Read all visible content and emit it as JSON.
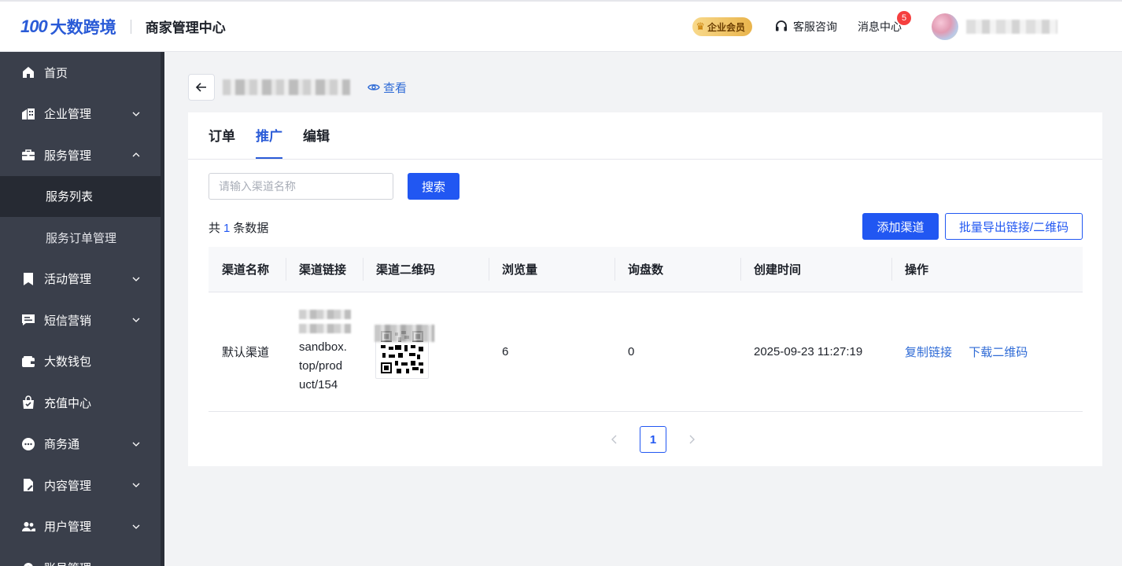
{
  "header": {
    "logo_mark": "100",
    "logo_text": "大数跨境",
    "center_title": "商家管理中心",
    "vip_label": "企业会员",
    "support_label": "客服咨询",
    "message_label": "消息中心",
    "message_count": "5"
  },
  "sidebar": {
    "items": [
      {
        "label": "首页",
        "icon": "home-icon",
        "chevron": "none"
      },
      {
        "label": "企业管理",
        "icon": "building-icon",
        "chevron": "down"
      },
      {
        "label": "服务管理",
        "icon": "briefcase-icon",
        "chevron": "up"
      },
      {
        "label": "活动管理",
        "icon": "bookmark-icon",
        "chevron": "down"
      },
      {
        "label": "短信营销",
        "icon": "message-icon",
        "chevron": "down"
      },
      {
        "label": "大数钱包",
        "icon": "wallet-icon",
        "chevron": "none"
      },
      {
        "label": "充值中心",
        "icon": "bag-icon",
        "chevron": "none"
      },
      {
        "label": "商务通",
        "icon": "chat-icon",
        "chevron": "down"
      },
      {
        "label": "内容管理",
        "icon": "document-icon",
        "chevron": "down"
      },
      {
        "label": "用户管理",
        "icon": "users-icon",
        "chevron": "down"
      },
      {
        "label": "账号管理",
        "icon": "gear-icon",
        "chevron": "none"
      }
    ],
    "sub_items": [
      {
        "label": "服务列表",
        "active": true
      },
      {
        "label": "服务订单管理",
        "active": false
      }
    ]
  },
  "page": {
    "view_label": "查看",
    "tabs": [
      {
        "label": "订单",
        "active": false
      },
      {
        "label": "推广",
        "active": true
      },
      {
        "label": "编辑",
        "active": false
      }
    ],
    "search_placeholder": "请输入渠道名称",
    "search_button": "搜索",
    "count_prefix": "共",
    "count_value": "1",
    "count_suffix": "条数据",
    "add_button": "添加渠道",
    "export_button": "批量导出链接/二维码"
  },
  "table": {
    "columns": [
      "渠道名称",
      "渠道链接",
      "渠道二维码",
      "浏览量",
      "询盘数",
      "创建时间",
      "操作"
    ],
    "rows": [
      {
        "name": "默认渠道",
        "link_lines": [
          "sandbox.",
          "top/prod",
          "uct/154"
        ],
        "views": "6",
        "inquiries": "0",
        "created": "2025-09-23 11:27:19",
        "op_copy": "复制链接",
        "op_download": "下载二维码"
      }
    ]
  },
  "pagination": {
    "current": "1"
  },
  "colors": {
    "accent": "#2157f2",
    "sidebar_bg": "#3a3f4b",
    "sidebar_active": "#262a33",
    "badge": "#f53f3f"
  }
}
